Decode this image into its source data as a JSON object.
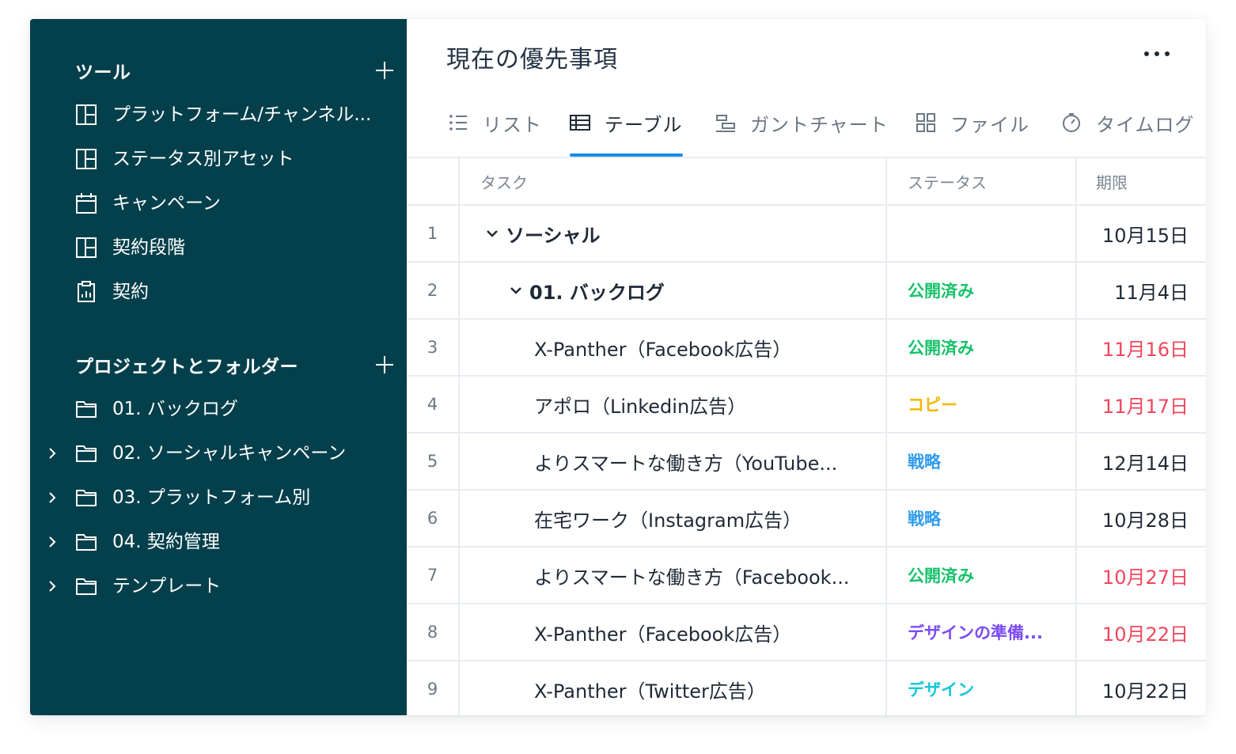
{
  "colors": {
    "sidebar_bg": "#04404c",
    "accent_tab": "#1a8ce8",
    "status_published": "#16c26a",
    "status_copy": "#f5b800",
    "status_strategy": "#2e9bf0",
    "status_design_prep": "#7a4cf5",
    "status_design": "#12c6dc",
    "date_overdue": "#f0465e"
  },
  "sidebar": {
    "tools": {
      "title": "ツール",
      "items": [
        {
          "label": "プラットフォーム/チャンネル...",
          "icon": "board-icon"
        },
        {
          "label": "ステータス別アセット",
          "icon": "board-icon"
        },
        {
          "label": "キャンペーン",
          "icon": "calendar-icon"
        },
        {
          "label": "契約段階",
          "icon": "board-icon"
        },
        {
          "label": "契約",
          "icon": "report-icon"
        }
      ]
    },
    "projects": {
      "title": "プロジェクトとフォルダー",
      "items": [
        {
          "label": "01. バックログ",
          "icon": "folder-icon",
          "expandable": false
        },
        {
          "label": "02. ソーシャルキャンペーン",
          "icon": "folder-icon",
          "expandable": true
        },
        {
          "label": "03. プラットフォーム別",
          "icon": "folder-icon",
          "expandable": true
        },
        {
          "label": "04. 契約管理",
          "icon": "folder-icon",
          "expandable": true
        },
        {
          "label": "テンプレート",
          "icon": "folder-icon",
          "expandable": true
        }
      ]
    }
  },
  "main": {
    "title": "現在の優先事項",
    "tabs": [
      {
        "label": "リスト",
        "icon": "list-icon"
      },
      {
        "label": "テーブル",
        "icon": "table-icon",
        "active": true
      },
      {
        "label": "ガントチャート",
        "icon": "gantt-icon"
      },
      {
        "label": "ファイル",
        "icon": "grid-icon"
      },
      {
        "label": "タイムログ",
        "icon": "stopwatch-icon"
      }
    ],
    "table": {
      "headers": {
        "task": "タスク",
        "status": "ステータス",
        "due": "期限"
      },
      "rows": [
        {
          "num": "1",
          "task": "ソーシャル",
          "status": "",
          "due": "10月15日",
          "level": 0,
          "group": true
        },
        {
          "num": "2",
          "task": "01. バックログ",
          "status": "公開済み",
          "status_color": "#16c26a",
          "due": "11月4日",
          "level": 1,
          "group": true
        },
        {
          "num": "3",
          "task": "X-Panther（Facebook広告）",
          "status": "公開済み",
          "status_color": "#16c26a",
          "due": "11月16日",
          "overdue": true,
          "level": 2
        },
        {
          "num": "4",
          "task": "アポロ（Linkedin広告）",
          "status": "コピー",
          "status_color": "#f5b800",
          "due": "11月17日",
          "overdue": true,
          "level": 2
        },
        {
          "num": "5",
          "task": "よりスマートな働き方（YouTube...",
          "status": "戦略",
          "status_color": "#2e9bf0",
          "due": "12月14日",
          "level": 2
        },
        {
          "num": "6",
          "task": "在宅ワーク（Instagram広告）",
          "status": "戦略",
          "status_color": "#2e9bf0",
          "due": "10月28日",
          "level": 2
        },
        {
          "num": "7",
          "task": "よりスマートな働き方（Facebook...",
          "status": "公開済み",
          "status_color": "#16c26a",
          "due": "10月27日",
          "overdue": true,
          "level": 2
        },
        {
          "num": "8",
          "task": "X-Panther（Facebook広告）",
          "status": "デザインの準備...",
          "status_color": "#7a4cf5",
          "due": "10月22日",
          "overdue": true,
          "level": 2
        },
        {
          "num": "9",
          "task": "X-Panther（Twitter広告）",
          "status": "デザイン",
          "status_color": "#12c6dc",
          "due": "10月22日",
          "level": 2
        }
      ]
    }
  }
}
